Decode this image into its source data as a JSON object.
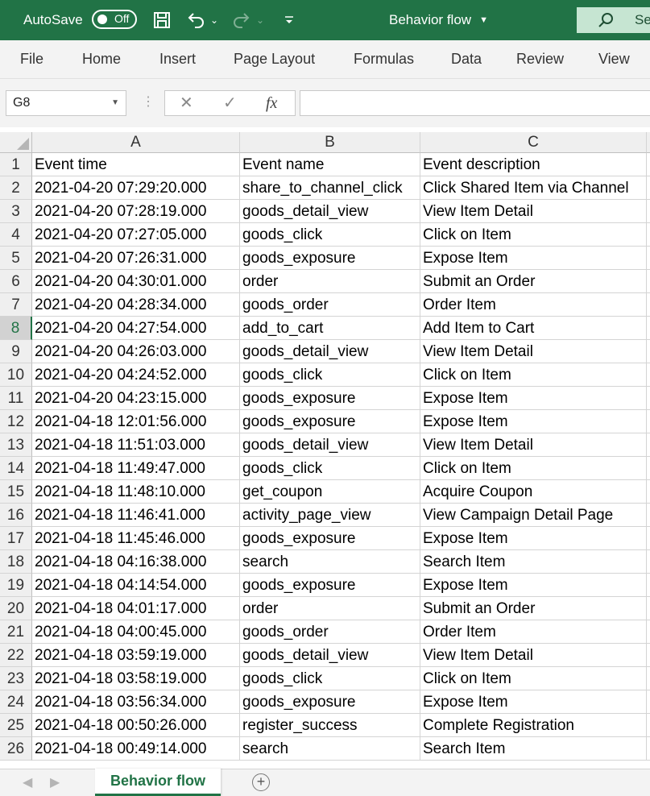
{
  "titlebar": {
    "autosave_label": "AutoSave",
    "autosave_state": "Off",
    "save_icon": "save-icon",
    "undo_icon": "undo-icon",
    "redo_icon": "redo-icon",
    "file_title": "Behavior flow",
    "search_label": "Se",
    "bg_color": "#217346"
  },
  "ribbon": {
    "tabs": [
      "File",
      "Home",
      "Insert",
      "Page Layout",
      "Formulas",
      "Data",
      "Review",
      "View"
    ]
  },
  "formula_bar": {
    "name_box": "G8",
    "cancel_glyph": "✕",
    "enter_glyph": "✓",
    "fx": "fx",
    "value": ""
  },
  "grid": {
    "columns": [
      "A",
      "B",
      "C"
    ],
    "selected_row": 8,
    "rows": [
      {
        "num": "1",
        "a": "Event time",
        "b": "Event name",
        "c": "Event description"
      },
      {
        "num": "2",
        "a": "2021-04-20 07:29:20.000",
        "b": "share_to_channel_click",
        "c": "Click Shared Item via Channel"
      },
      {
        "num": "3",
        "a": "2021-04-20 07:28:19.000",
        "b": "goods_detail_view",
        "c": "View Item Detail"
      },
      {
        "num": "4",
        "a": "2021-04-20 07:27:05.000",
        "b": "goods_click",
        "c": "Click on Item"
      },
      {
        "num": "5",
        "a": "2021-04-20 07:26:31.000",
        "b": "goods_exposure",
        "c": "Expose Item"
      },
      {
        "num": "6",
        "a": "2021-04-20 04:30:01.000",
        "b": "order",
        "c": "Submit an Order"
      },
      {
        "num": "7",
        "a": "2021-04-20 04:28:34.000",
        "b": "goods_order",
        "c": "Order Item"
      },
      {
        "num": "8",
        "a": "2021-04-20 04:27:54.000",
        "b": "add_to_cart",
        "c": "Add Item to Cart"
      },
      {
        "num": "9",
        "a": "2021-04-20 04:26:03.000",
        "b": "goods_detail_view",
        "c": "View Item Detail"
      },
      {
        "num": "10",
        "a": "2021-04-20 04:24:52.000",
        "b": "goods_click",
        "c": "Click on Item"
      },
      {
        "num": "11",
        "a": "2021-04-20 04:23:15.000",
        "b": "goods_exposure",
        "c": "Expose Item"
      },
      {
        "num": "12",
        "a": "2021-04-18 12:01:56.000",
        "b": "goods_exposure",
        "c": "Expose Item"
      },
      {
        "num": "13",
        "a": "2021-04-18 11:51:03.000",
        "b": "goods_detail_view",
        "c": "View Item Detail"
      },
      {
        "num": "14",
        "a": "2021-04-18 11:49:47.000",
        "b": "goods_click",
        "c": "Click on Item"
      },
      {
        "num": "15",
        "a": "2021-04-18 11:48:10.000",
        "b": "get_coupon",
        "c": "Acquire Coupon"
      },
      {
        "num": "16",
        "a": "2021-04-18 11:46:41.000",
        "b": "activity_page_view",
        "c": "View Campaign Detail Page"
      },
      {
        "num": "17",
        "a": "2021-04-18 11:45:46.000",
        "b": "goods_exposure",
        "c": "Expose Item"
      },
      {
        "num": "18",
        "a": "2021-04-18 04:16:38.000",
        "b": "search",
        "c": "Search Item"
      },
      {
        "num": "19",
        "a": "2021-04-18 04:14:54.000",
        "b": "goods_exposure",
        "c": "Expose Item"
      },
      {
        "num": "20",
        "a": "2021-04-18 04:01:17.000",
        "b": "order",
        "c": "Submit an Order"
      },
      {
        "num": "21",
        "a": "2021-04-18 04:00:45.000",
        "b": "goods_order",
        "c": "Order Item"
      },
      {
        "num": "22",
        "a": "2021-04-18 03:59:19.000",
        "b": "goods_detail_view",
        "c": "View Item Detail"
      },
      {
        "num": "23",
        "a": "2021-04-18 03:58:19.000",
        "b": "goods_click",
        "c": "Click on Item"
      },
      {
        "num": "24",
        "a": "2021-04-18 03:56:34.000",
        "b": "goods_exposure",
        "c": "Expose Item"
      },
      {
        "num": "25",
        "a": "2021-04-18 00:50:26.000",
        "b": "register_success",
        "c": "Complete Registration"
      },
      {
        "num": "26",
        "a": "2021-04-18 00:49:14.000",
        "b": "search",
        "c": "Search Item"
      }
    ]
  },
  "sheets": {
    "active": "Behavior flow",
    "add_glyph": "+"
  }
}
